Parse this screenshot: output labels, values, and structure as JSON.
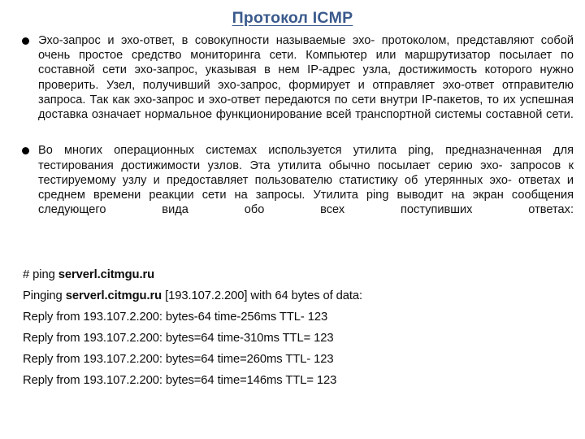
{
  "slide": {
    "title": "Протокол ICMP",
    "title_color": "#3a5a8c",
    "background_color": "#ffffff",
    "text_color": "#111111"
  },
  "bullets": [
    {
      "marker": "filled-circle-bullet",
      "text": "Эхо-запрос и эхо-ответ, в совокупности называемые эхо- протоколом, представляют собой очень простое средство мониторинга сети. Компьютер или маршрутизатор посылает по составной сети эхо-запрос, указывая в нем IP-адрес узла, достижимость которого нужно проверить. Узел, получивший эхо-запрос, формирует и отправляет эхо-ответ отправителю запроса. Так как эхо-запрос и эхо-ответ передаются по сети внутри IP-пакетов, то их успешная доставка означает нормальное функционирование всей транспортной системы составной сети."
    },
    {
      "marker": "filled-circle-bullet",
      "text": "Во многих операционных системах используется утилита ping, предназначенная для тестирования достижимости узлов. Эта утилита обычно посылает серию эхо- запросов к тестируемому узлу и предоставляет пользователю статистику об утерянных эхо- ответах и среднем времени реакции сети на запросы. Утилита ping выводит на экран сообщения следующего вида обо всех поступивших ответах:"
    }
  ],
  "console": {
    "command_prefix": "# ping ",
    "command_host": "serverl.citmgu.ru",
    "pinging_prefix": "Pinging ",
    "pinging_host": "serverl.citmgu.ru",
    "pinging_suffix": " [193.107.2.200] with 64 bytes of data:",
    "replies": [
      "Reply from 193.107.2.200: bytes-64 time-256ms TTL- 123",
      "Reply from 193.107.2.200: bytes=64 time-310ms TTL= 123",
      "Reply from 193.107.2.200: bytes=64 time=260ms TTL- 123",
      "Reply from 193.107.2.200: bytes=64 time=146ms TTL= 123"
    ]
  }
}
